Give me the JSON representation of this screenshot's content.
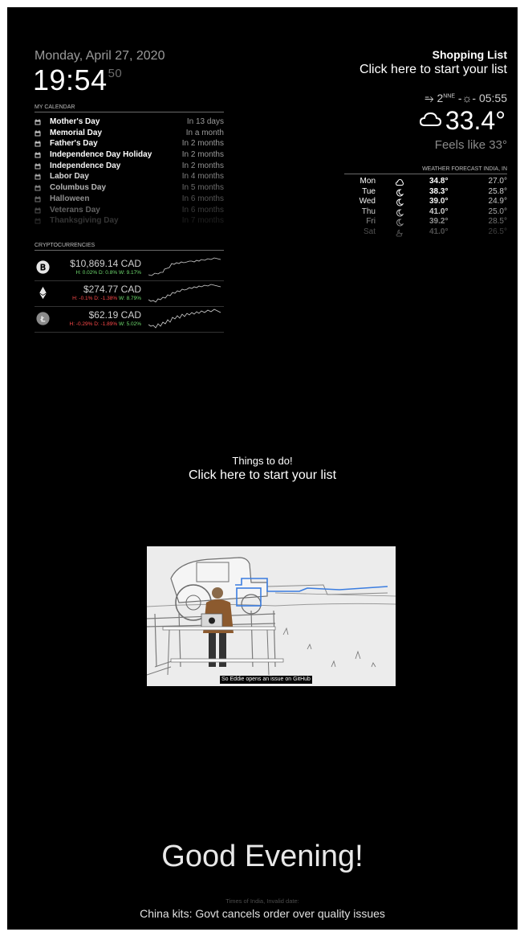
{
  "clock": {
    "date": "Monday, April 27, 2020",
    "time": "19:54",
    "seconds": "50"
  },
  "calendar": {
    "header": "MY CALENDAR",
    "events": [
      {
        "title": "Mother's Day",
        "time": "In 13 days",
        "opacity": 1.0
      },
      {
        "title": "Memorial Day",
        "time": "In a month",
        "opacity": 1.0
      },
      {
        "title": "Father's Day",
        "time": "In 2 months",
        "opacity": 1.0
      },
      {
        "title": "Independence Day Holiday",
        "time": "In 2 months",
        "opacity": 1.0
      },
      {
        "title": "Independence Day",
        "time": "In 2 months",
        "opacity": 0.95
      },
      {
        "title": "Labor Day",
        "time": "In 4 months",
        "opacity": 0.85
      },
      {
        "title": "Columbus Day",
        "time": "In 5 months",
        "opacity": 0.7
      },
      {
        "title": "Halloween",
        "time": "In 6 months",
        "opacity": 0.55
      },
      {
        "title": "Veterans Day",
        "time": "In 6 months",
        "opacity": 0.38
      },
      {
        "title": "Thanksgiving Day",
        "time": "In 7 months",
        "opacity": 0.2
      }
    ]
  },
  "crypto": {
    "header": "CRYPTOCURRENCIES",
    "coins": [
      {
        "icon": "bitcoin-icon",
        "price": "$10,869.14 CAD",
        "h": "H: 0.02%",
        "h_dir": "pos",
        "d": "D: 0.8%",
        "d_dir": "pos",
        "w": "W: 9.17%",
        "w_dir": "pos"
      },
      {
        "icon": "ethereum-icon",
        "price": "$274.77 CAD",
        "h": "H: -0.1%",
        "h_dir": "neg",
        "d": "D: -1.38%",
        "d_dir": "neg",
        "w": "W: 8.79%",
        "w_dir": "pos"
      },
      {
        "icon": "litecoin-icon",
        "price": "$62.19 CAD",
        "h": "H: -0.29%",
        "h_dir": "neg",
        "d": "D: -1.89%",
        "d_dir": "neg",
        "w": "W: 5.02%",
        "w_dir": "pos"
      }
    ]
  },
  "shopping": {
    "title": "Shopping List",
    "subtitle": "Click here to start your list"
  },
  "weather": {
    "wind_speed": "2",
    "wind_dir": "NNE",
    "sun_time": "05:55",
    "temperature": "33.4°",
    "feels_like": "Feels like 33°",
    "forecast_header": "WEATHER FORECAST INDIA, IN",
    "forecast": [
      {
        "day": "Mon",
        "icon": "cloudy-icon",
        "hi": "34.8°",
        "lo": "27.0°",
        "opacity": 1.0
      },
      {
        "day": "Tue",
        "icon": "moon-icon",
        "hi": "38.3°",
        "lo": "25.8°",
        "opacity": 1.0
      },
      {
        "day": "Wed",
        "icon": "moon-icon",
        "hi": "39.0°",
        "lo": "24.9°",
        "opacity": 0.95
      },
      {
        "day": "Thu",
        "icon": "moon-icon",
        "hi": "41.0°",
        "lo": "25.0°",
        "opacity": 0.8
      },
      {
        "day": "Fri",
        "icon": "moon-icon",
        "hi": "39.2°",
        "lo": "28.5°",
        "opacity": 0.55
      },
      {
        "day": "Sat",
        "icon": "cloud-moon-icon",
        "hi": "41.0°",
        "lo": "26.5°",
        "opacity": 0.3
      }
    ]
  },
  "todo": {
    "title": "Things to do!",
    "subtitle": "Click here to start your list"
  },
  "video": {
    "caption": "So Eddie opens an issue on GitHub"
  },
  "greeting": "Good Evening!",
  "news": {
    "source": "Times of India, Invalid date:",
    "headline": "China kits: Govt cancels order over quality issues"
  },
  "colors": {
    "background": "#000000",
    "positive": "#6fdc6f",
    "negative": "#ff4a4a",
    "muted": "#9a9a9a"
  }
}
